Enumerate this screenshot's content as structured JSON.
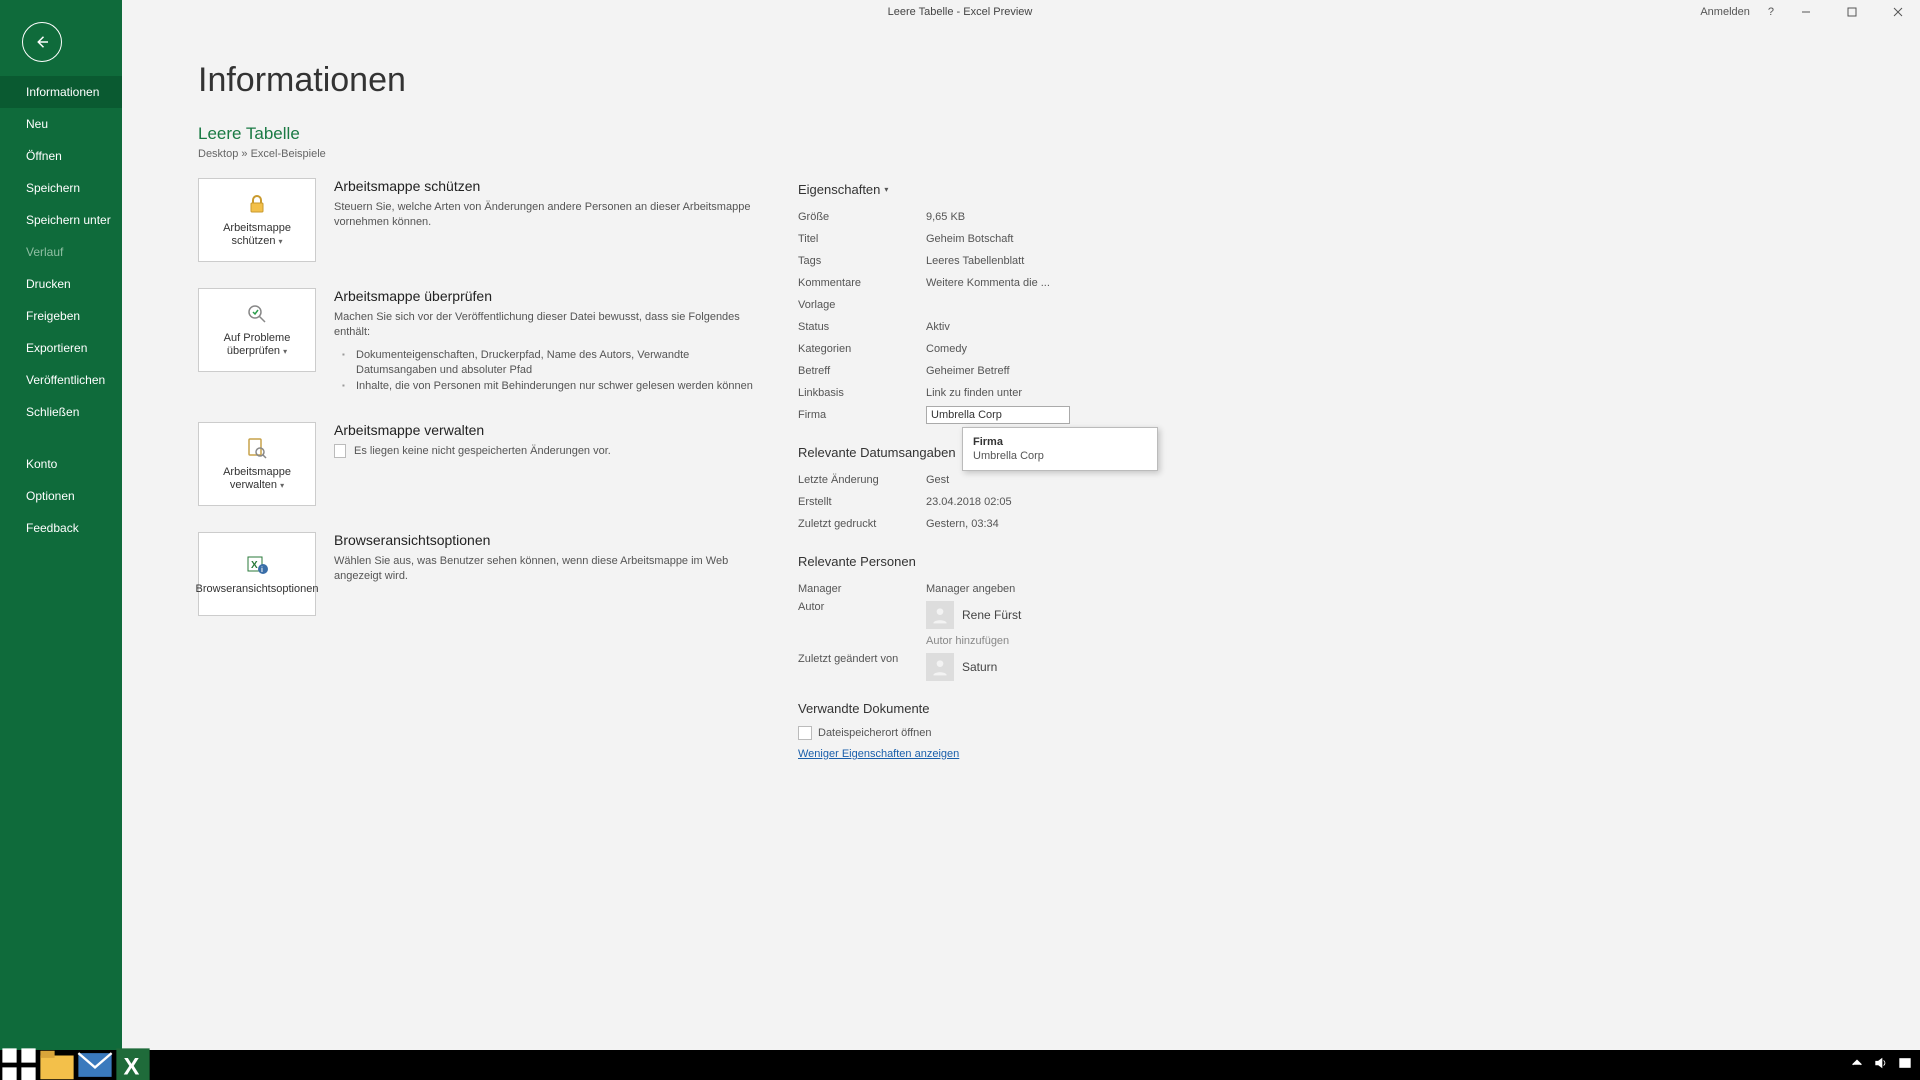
{
  "titlebar": {
    "title": "Leere Tabelle  -  Excel Preview",
    "signin": "Anmelden",
    "help": "?"
  },
  "sidebar": {
    "items": [
      {
        "label": "Informationen",
        "active": true
      },
      {
        "label": "Neu"
      },
      {
        "label": "Öffnen"
      },
      {
        "label": "Speichern"
      },
      {
        "label": "Speichern unter"
      },
      {
        "label": "Verlauf",
        "disabled": true
      },
      {
        "label": "Drucken"
      },
      {
        "label": "Freigeben"
      },
      {
        "label": "Exportieren"
      },
      {
        "label": "Veröffentlichen"
      },
      {
        "label": "Schließen"
      }
    ],
    "items2": [
      {
        "label": "Konto"
      },
      {
        "label": "Optionen"
      },
      {
        "label": "Feedback"
      }
    ]
  },
  "page": {
    "title": "Informationen",
    "doc_title": "Leere Tabelle",
    "breadcrumb": "Desktop » Excel-Beispiele"
  },
  "actions": {
    "protect": {
      "card_label": "Arbeitsmappe schützen",
      "title": "Arbeitsmappe schützen",
      "text": "Steuern Sie, welche Arten von Änderungen andere Personen an dieser Arbeitsmappe vornehmen können."
    },
    "inspect": {
      "card_label": "Auf Probleme überprüfen",
      "title": "Arbeitsmappe überprüfen",
      "text": "Machen Sie sich vor der Veröffentlichung dieser Datei bewusst, dass sie Folgendes enthält:",
      "bullet1": "Dokumenteigenschaften, Druckerpfad, Name des Autors, Verwandte Datumsangaben und absoluter Pfad",
      "bullet2": "Inhalte, die von Personen mit Behinderungen nur schwer gelesen werden können"
    },
    "manage": {
      "card_label": "Arbeitsmappe verwalten",
      "title": "Arbeitsmappe verwalten",
      "text": "Es liegen keine nicht gespeicherten Änderungen vor."
    },
    "browser": {
      "card_label": "Browseransichtsoptionen",
      "title": "Browseransichtsoptionen",
      "text": "Wählen Sie aus, was Benutzer sehen können, wenn diese Arbeitsmappe im Web angezeigt wird."
    }
  },
  "props": {
    "header": "Eigenschaften",
    "size_k": "Größe",
    "size_v": "9,65 KB",
    "title_k": "Titel",
    "title_v": "Geheim Botschaft",
    "tags_k": "Tags",
    "tags_v": "Leeres Tabellenblatt",
    "comments_k": "Kommentare",
    "comments_v": "Weitere Kommenta die ...",
    "template_k": "Vorlage",
    "template_v": "",
    "status_k": "Status",
    "status_v": "Aktiv",
    "cats_k": "Kategorien",
    "cats_v": "Comedy",
    "subject_k": "Betreff",
    "subject_v": "Geheimer Betreff",
    "linkbase_k": "Linkbasis",
    "linkbase_v": "Link zu finden unter",
    "company_k": "Firma",
    "company_v": "Umbrella Corp"
  },
  "tooltip": {
    "t1": "Firma",
    "t2": "Umbrella Corp"
  },
  "dates": {
    "header": "Relevante Datumsangaben",
    "lastmod_k": "Letzte Änderung",
    "lastmod_v": "Gest",
    "created_k": "Erstellt",
    "created_v": "23.04.2018 02:05",
    "printed_k": "Zuletzt gedruckt",
    "printed_v": "Gestern, 03:34"
  },
  "people": {
    "header": "Relevante Personen",
    "manager_k": "Manager",
    "manager_v": "Manager angeben",
    "author_k": "Autor",
    "author_name": "Rene Fürst",
    "author_add": "Autor hinzufügen",
    "lastmodby_k": "Zuletzt geändert von",
    "lastmodby_name": "Saturn"
  },
  "related": {
    "header": "Verwandte Dokumente",
    "open_loc": "Dateispeicherort öffnen",
    "fewer_props": "Weniger Eigenschaften anzeigen"
  }
}
